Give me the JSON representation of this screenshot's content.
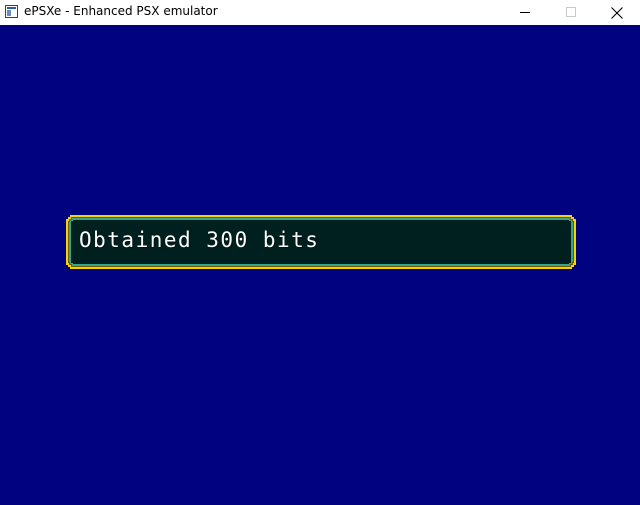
{
  "window": {
    "title": "ePSXe - Enhanced PSX emulator",
    "buttons": {
      "minimize": "minimize-icon",
      "maximize": "maximize-icon",
      "close": "close-icon"
    }
  },
  "game": {
    "background_color": "#01027f",
    "dialog": {
      "message": "Obtained 300 bits",
      "border_color": "#f5d400",
      "inner_border_color": "#3aa58a",
      "fill_color": "#002020"
    }
  }
}
